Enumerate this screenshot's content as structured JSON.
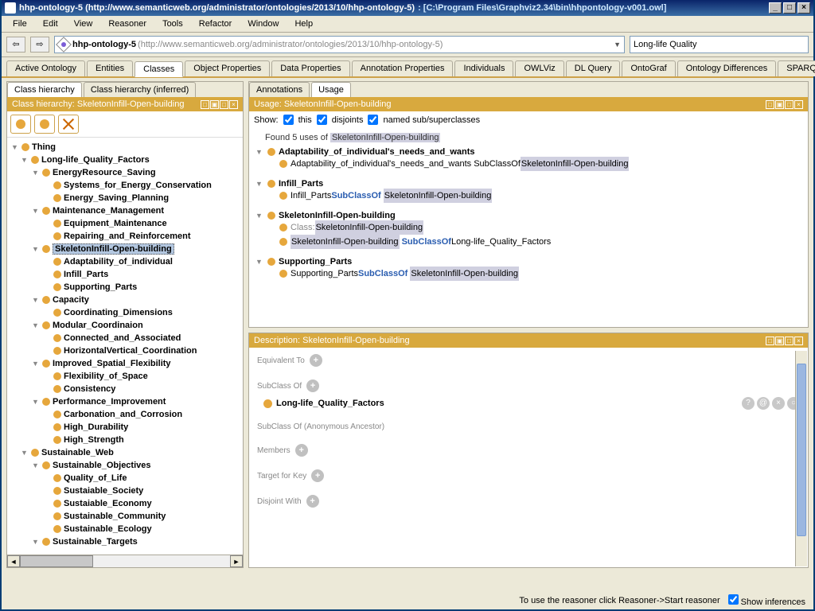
{
  "window": {
    "title_a": "hhp-ontology-5 (http://www.semanticweb.org/administrator/ontologies/2013/10/hhp-ontology-5)",
    "title_b": " : [C:\\Program Files\\Graphviz2.34\\bin\\hhpontology-v001.owl]"
  },
  "menu": [
    "File",
    "Edit",
    "View",
    "Reasoner",
    "Tools",
    "Refactor",
    "Window",
    "Help"
  ],
  "address": {
    "name": "hhp-ontology-5",
    "url": "(http://www.semanticweb.org/administrator/ontologies/2013/10/hhp-ontology-5)"
  },
  "search": {
    "value": "Long-life Quality"
  },
  "main_tabs": [
    "Active Ontology",
    "Entities",
    "Classes",
    "Object Properties",
    "Data Properties",
    "Annotation Properties",
    "Individuals",
    "OWLViz",
    "DL Query",
    "OntoGraf",
    "Ontology Differences",
    "SPARQL Query"
  ],
  "left": {
    "subtabs": [
      "Class hierarchy",
      "Class hierarchy (inferred)"
    ],
    "panel_title": "Class hierarchy: SkeletonInfill-Open-building",
    "tree": {
      "root": "Thing",
      "n1": "Long-life_Quality_Factors",
      "n1a": "EnergyResource_Saving",
      "n1a1": "Systems_for_Energy_Conservation",
      "n1a2": "Energy_Saving_Planning",
      "n1b": "Maintenance_Management",
      "n1b1": "Equipment_Maintenance",
      "n1b2": "Repairing_and_Reinforcement",
      "n1c": "SkeletonInfill-Open-building",
      "n1c1": "Adaptability_of_individual",
      "n1c2": "Infill_Parts",
      "n1c3": "Supporting_Parts",
      "n1d": "Capacity",
      "n1d1": "Coordinating_Dimensions",
      "n1e": "Modular_Coordinaion",
      "n1e1": "Connected_and_Associated",
      "n1e2": "HorizontalVertical_Coordination",
      "n1f": "Improved_Spatial_Flexibility",
      "n1f1": "Flexibility_of_Space",
      "n1f2": "Consistency",
      "n1g": "Performance_Improvement",
      "n1g1": "Carbonation_and_Corrosion",
      "n1g2": "High_Durability",
      "n1g3": "High_Strength",
      "n2": "Sustainable_Web",
      "n2a": "Sustainable_Objectives",
      "n2a1": "Quality_of_Life",
      "n2a2": "Sustaiable_Society",
      "n2a3": "Sustaiable_Economy",
      "n2a4": "Sustainable_Community",
      "n2a5": "Sustainable_Ecology",
      "n2b": "Sustainable_Targets"
    }
  },
  "right": {
    "subtabs": [
      "Annotations",
      "Usage"
    ],
    "panel_title": "Usage: SkeletonInfill-Open-building",
    "show_label": "Show:",
    "show_opts": [
      "this",
      "disjoints",
      "named sub/superclasses"
    ],
    "headline_a": "Found 5 uses of ",
    "headline_b": "SkeletonInfill-Open-building",
    "g1": {
      "head": "Adaptability_of_individual's_needs_and_wants",
      "l1a": "Adaptability_of_individual's_needs_and_wants SubClassOf ",
      "l1b": "SkeletonInfill-Open-building"
    },
    "g2": {
      "head": "Infill_Parts",
      "l1a": "Infill_Parts ",
      "kw": "SubClassOf",
      "l1b": "SkeletonInfill-Open-building"
    },
    "g3": {
      "head": "SkeletonInfill-Open-building",
      "l1a": "Class: ",
      "l1b": "SkeletonInfill-Open-building",
      "l2a": "SkeletonInfill-Open-building",
      "kw": "SubClassOf",
      "l2b": " Long-life_Quality_Factors"
    },
    "g4": {
      "head": "Supporting_Parts",
      "l1a": "Supporting_Parts ",
      "kw": "SubClassOf",
      "l1b": "SkeletonInfill-Open-building"
    }
  },
  "desc": {
    "panel_title": "Description: SkeletonInfill-Open-building",
    "eq": "Equivalent To",
    "sc": "SubClass Of",
    "sc_val": "Long-life_Quality_Factors",
    "sca": "SubClass Of (Anonymous Ancestor)",
    "mem": "Members",
    "tk": "Target for Key",
    "dw": "Disjoint With"
  },
  "status": {
    "text": "To use the reasoner click Reasoner->Start reasoner",
    "check": "Show inferences"
  }
}
